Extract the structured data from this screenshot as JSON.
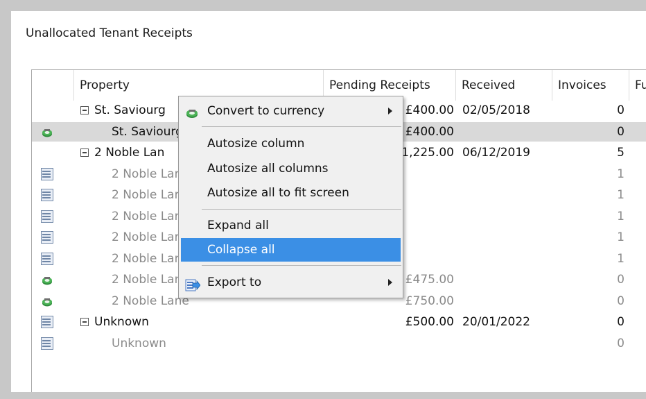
{
  "title": "Unallocated Tenant Receipts",
  "columns": [
    "Property",
    "Pending Receipts",
    "Received",
    "Invoices",
    "Fu"
  ],
  "rows": [
    {
      "icon": "",
      "expander": true,
      "property": "St. Saviourg",
      "pending": "£400.00",
      "received": "02/05/2018",
      "invoices": "0",
      "dim": false
    },
    {
      "icon": "money-icon",
      "expander": false,
      "property": "St. Saviourg",
      "pending": "£400.00",
      "received": "",
      "invoices": "0",
      "dim": false
    },
    {
      "icon": "",
      "expander": true,
      "property": "2 Noble Lan",
      "pending": "£1,225.00",
      "received": "06/12/2019",
      "invoices": "5",
      "dim": false
    },
    {
      "icon": "list-icon",
      "expander": false,
      "property": "2 Noble Lan",
      "pending": "",
      "received": "",
      "invoices": "1",
      "dim": true
    },
    {
      "icon": "list-icon",
      "expander": false,
      "property": "2 Noble Lar",
      "pending": "",
      "received": "",
      "invoices": "1",
      "dim": true
    },
    {
      "icon": "list-icon",
      "expander": false,
      "property": "2 Noble Lar",
      "pending": "",
      "received": "",
      "invoices": "1",
      "dim": true
    },
    {
      "icon": "list-icon",
      "expander": false,
      "property": "2 Noble Lar",
      "pending": "",
      "received": "",
      "invoices": "1",
      "dim": true
    },
    {
      "icon": "list-icon",
      "expander": false,
      "property": "2 Noble Lar",
      "pending": "",
      "received": "",
      "invoices": "1",
      "dim": true
    },
    {
      "icon": "money-icon",
      "expander": false,
      "property": "2 Noble Lane",
      "pending": "£475.00",
      "received": "",
      "invoices": "0",
      "dim": true
    },
    {
      "icon": "money-icon",
      "expander": false,
      "property": "2 Noble Lane",
      "pending": "£750.00",
      "received": "",
      "invoices": "0",
      "dim": true
    },
    {
      "icon": "list-icon",
      "expander": true,
      "property": "Unknown",
      "pending": "£500.00",
      "received": "20/01/2022",
      "invoices": "0",
      "dim": false
    },
    {
      "icon": "list-icon",
      "expander": false,
      "property": "Unknown",
      "pending": "",
      "received": "",
      "invoices": "0",
      "dim": true
    }
  ],
  "selected_row": 1,
  "context_menu": {
    "items": [
      {
        "label": "Convert to currency",
        "icon": "money-icon",
        "submenu": true
      },
      {
        "label": "Autosize column"
      },
      {
        "label": "Autosize all columns"
      },
      {
        "label": "Autosize all to fit screen"
      },
      {
        "label": "Expand all"
      },
      {
        "label": "Collapse all",
        "highlighted": true
      },
      {
        "label": "Export to",
        "icon": "export-icon",
        "submenu": true
      }
    ]
  },
  "colors": {
    "highlight": "#3b8fe5",
    "selected_row": "#d9d9d9",
    "dim_text": "#8a8a8a"
  }
}
